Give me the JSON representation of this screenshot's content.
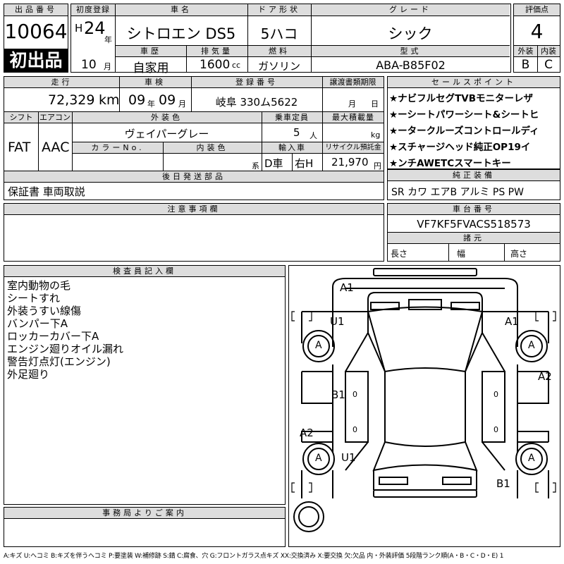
{
  "header": {
    "lot_label": "出品番号",
    "lot_number": "10064",
    "first_listing": "初出品",
    "first_reg_label": "初度登録",
    "era": "H",
    "year": "24",
    "year_unit": "年",
    "month": "10",
    "month_unit": "月",
    "name_label": "車名",
    "car_name": "シトロエン DS5",
    "door_label": "ドア形状",
    "door": "5ハコ",
    "grade_label": "グレード",
    "grade": "シック",
    "score_label": "評価点",
    "score": "4",
    "history_label": "車歴",
    "history": "自家用",
    "displacement_label": "排気量",
    "displacement": "1600",
    "displacement_unit": "cc",
    "fuel_label": "燃料",
    "fuel": "ガソリン",
    "model_label": "型式",
    "model": "ABA-B85F02",
    "exterior_label": "外装",
    "exterior": "B",
    "interior_label": "内装",
    "interior": "C"
  },
  "row2": {
    "mileage_label": "走行",
    "mileage": "72,329",
    "mileage_unit": "km",
    "inspection_label": "車検",
    "insp_year": "09",
    "insp_year_unit": "年",
    "insp_month": "09",
    "insp_month_unit": "月",
    "reg_label": "登録番号",
    "reg_number": "岐阜 330ム5622",
    "transfer_label": "譲渡書類期限",
    "transfer_month": "月",
    "transfer_day": "日",
    "shift_label": "シフト",
    "shift": "FAT",
    "ac_label": "エアコン",
    "ac": "AAC",
    "color_label": "外装色",
    "color": "ヴェイパーグレー",
    "capacity_label": "乗車定員",
    "capacity": "5",
    "capacity_unit": "人",
    "load_label": "最大積載量",
    "load_unit": "kg",
    "color_no_label": "カラーNo.",
    "int_color_label": "内装色",
    "int_color_suffix": "系",
    "import_label": "輸入車",
    "import_dealer": "D車",
    "steering": "右H",
    "recycle_label": "リサイクル預託金",
    "recycle": "21,970",
    "recycle_unit": "円"
  },
  "later_parts": {
    "label": "後日発送部品",
    "value": "保証書 車両取説"
  },
  "sales_points": {
    "label": "セールスポイント",
    "items": [
      "★ナビフルセグTVBモニターレザ",
      "★ーシートパワーシート&シートヒ",
      "★ータークルーズコントロールディ",
      "★スチャージヘッド純正OP19イ",
      "★ンチAWETCスマートキー"
    ]
  },
  "genuine": {
    "label": "純正装備",
    "value": "SR カワ エアB アルミ PS PW"
  },
  "notes": {
    "label": "注意事項欄"
  },
  "chassis": {
    "label": "車台番号",
    "value": "VF7KF5FVACS518573",
    "specs_label": "諸元",
    "length": "長さ",
    "width": "幅",
    "height": "高さ"
  },
  "inspector": {
    "label": "検査員記入欄",
    "lines": [
      "室内動物の毛",
      "シートすれ",
      "外装うすい線傷",
      "バンパー下A",
      "ロッカーカバー下A",
      "エンジン廻りオイル漏れ",
      "警告灯点灯(エンジン)",
      "外足廻り"
    ]
  },
  "diagram": {
    "marks": {
      "a1_top_left": "A1",
      "u1_left": "U1",
      "a1_top_right": "A1",
      "a_front_left": "A",
      "a_front_right": "A",
      "a2_right": "A2",
      "b1_left": "B1",
      "zero_b1": "0",
      "zero_right": "0",
      "zero_mid_left": "0",
      "zero_mid_right": "0",
      "a2_left": "A2",
      "a_rear_left": "A",
      "u1_rear": "U1",
      "a_rear_right": "A",
      "b1_rear": "B1"
    }
  },
  "office": {
    "label": "事務局よりご案内"
  },
  "legend": "A:キズ U:ヘコミ B:キズを伴うヘコミ P:要塗装 W:補修跡 S:錆 C:腐食、穴 G:フロントガラス点キズ XX:交換済み X:要交換 欠:欠品 内・外装評価 5段階ランク順(A・B・C・D・E) 1"
}
